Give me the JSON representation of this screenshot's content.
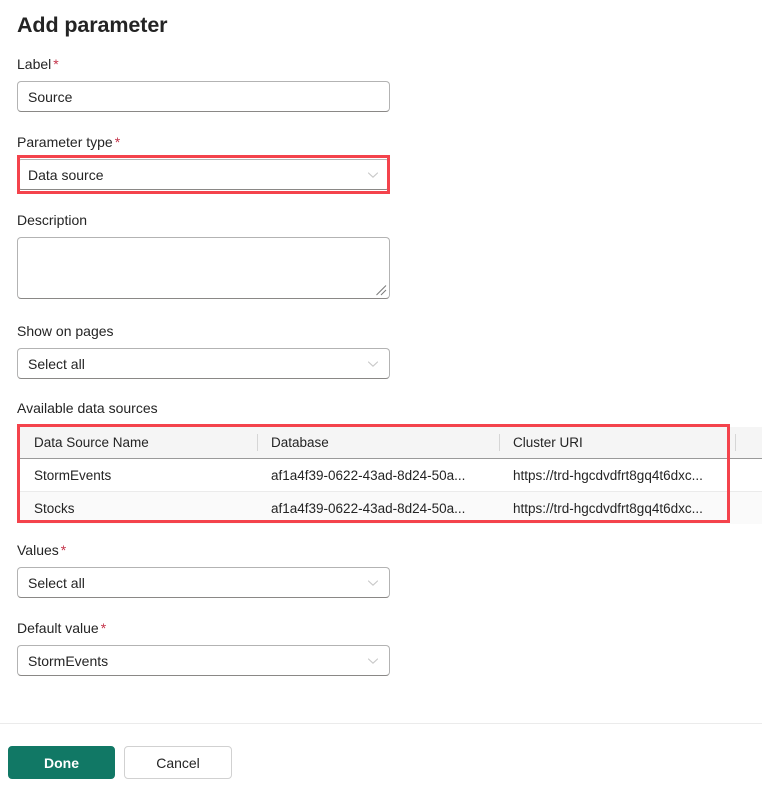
{
  "dialog": {
    "title": "Add parameter"
  },
  "fields": {
    "label": {
      "label": "Label",
      "required": "*",
      "value": "Source",
      "placeholder": "Source"
    },
    "parameter_type": {
      "label": "Parameter type",
      "required": "*",
      "value": "Data source",
      "icon": "chevron-down-icon",
      "highlighted": true
    },
    "description": {
      "label": "Description",
      "value": "",
      "placeholder": ""
    },
    "show_on_pages": {
      "label": "Show on pages",
      "value": "Select all",
      "icon": "chevron-down-icon"
    },
    "values": {
      "label": "Values",
      "required": "*",
      "value": "Select all",
      "icon": "chevron-down-icon"
    },
    "default_value": {
      "label": "Default value",
      "required": "*",
      "value": "StormEvents",
      "icon": "chevron-down-icon"
    }
  },
  "data_sources": {
    "section_label": "Available data sources",
    "highlighted": true,
    "columns": [
      "Data Source Name",
      "Database",
      "Cluster URI",
      ""
    ],
    "rows": [
      {
        "name": "StormEvents",
        "database": "af1a4f39-0622-43ad-8d24-50a...",
        "cluster_uri": "https://trd-hgcdvdfrt8gq4t6dxc...",
        "extra": ""
      },
      {
        "name": "Stocks",
        "database": "af1a4f39-0622-43ad-8d24-50a...",
        "cluster_uri": "https://trd-hgcdvdfrt8gq4t6dxc...",
        "extra": ""
      }
    ]
  },
  "footer": {
    "done_label": "Done",
    "cancel_label": "Cancel"
  },
  "colors": {
    "primary_green": "#117865",
    "annotation_red": "#f4434c",
    "required_red": "#c4344a",
    "text": "#242424",
    "border": "#b3b3b3",
    "header_bg": "#f5f5f5"
  }
}
